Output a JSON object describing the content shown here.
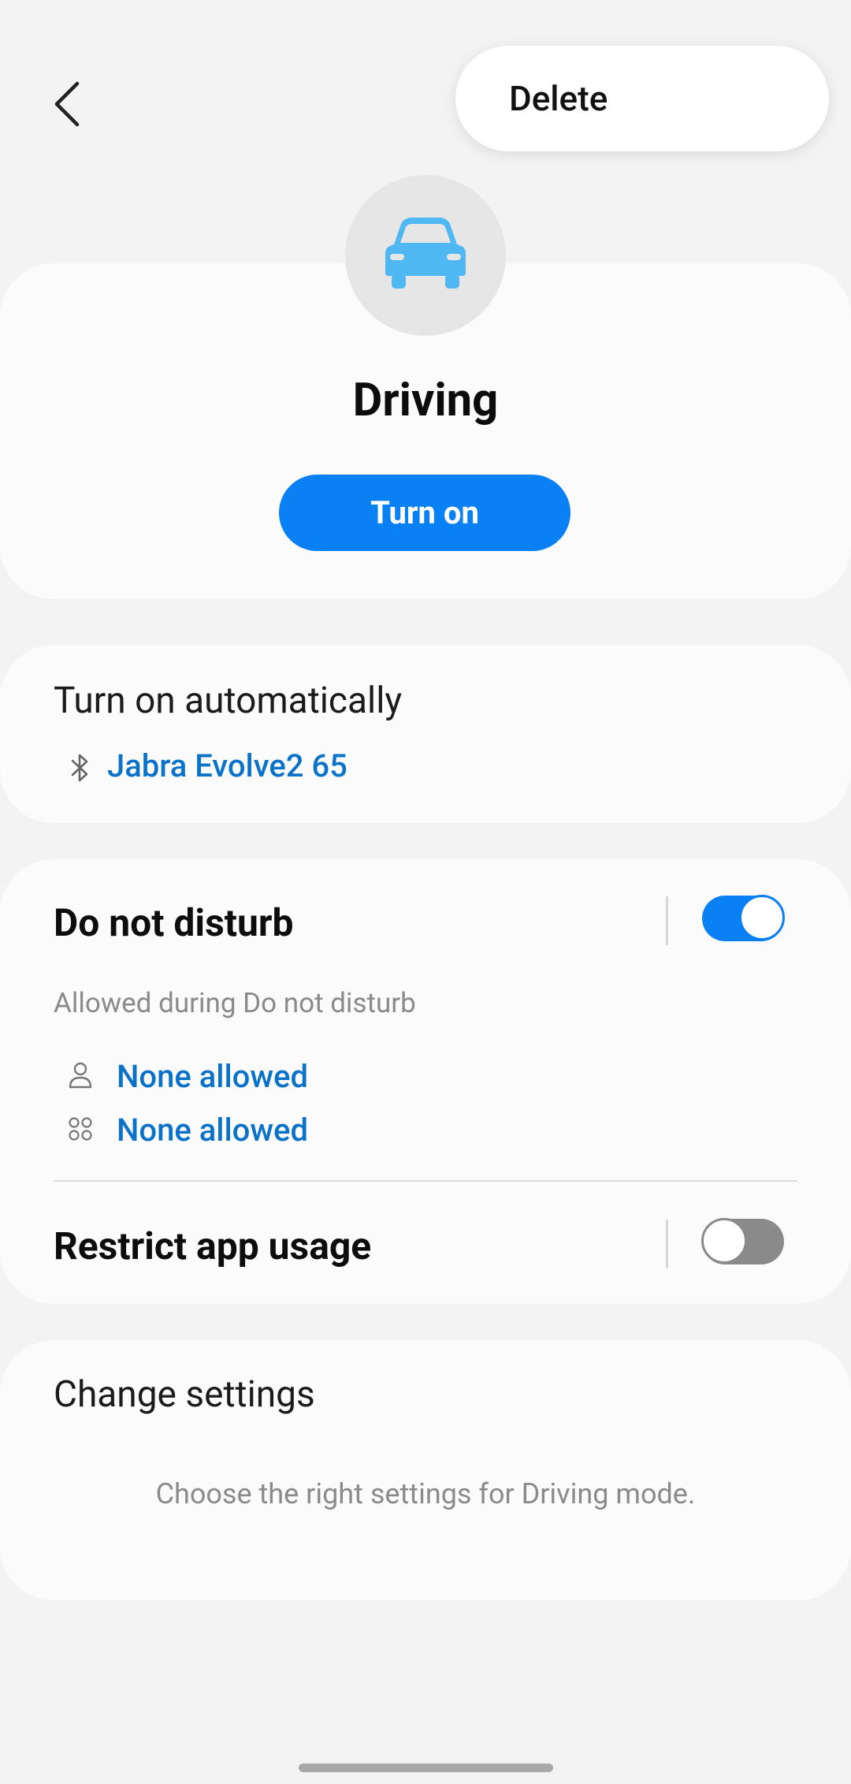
{
  "header": {
    "back_icon": "chevron-left-icon",
    "delete_label": "Delete"
  },
  "mode": {
    "icon": "car-icon",
    "title": "Driving",
    "turn_on_label": "Turn on"
  },
  "auto": {
    "title": "Turn on automatically",
    "trigger_icon": "bluetooth-icon",
    "trigger_label": "Jabra Evolve2 65"
  },
  "dnd": {
    "title": "Do not disturb",
    "enabled": true,
    "subtitle": "Allowed during Do not disturb",
    "people_icon": "person-icon",
    "people_value": "None allowed",
    "apps_icon": "apps-grid-icon",
    "apps_value": "None allowed"
  },
  "restrict": {
    "title": "Restrict app usage",
    "enabled": false
  },
  "change_settings": {
    "title": "Change settings",
    "description": "Choose the right settings for Driving mode."
  },
  "colors": {
    "accent": "#0a80f5",
    "link": "#0b72c9",
    "car_icon": "#4fb8f2"
  }
}
